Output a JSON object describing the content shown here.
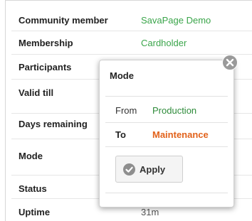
{
  "info": {
    "rows": [
      {
        "label": "Community member",
        "value": "SavaPage Demo"
      },
      {
        "label": "Membership",
        "value": "Cardholder"
      },
      {
        "label": "Participants",
        "value": ""
      },
      {
        "label": "Valid till",
        "value": ""
      },
      {
        "label": "Days remaining",
        "value": ""
      },
      {
        "label": "Mode",
        "value": ""
      },
      {
        "label": "Status",
        "value": ""
      },
      {
        "label": "Uptime",
        "value": "31m"
      }
    ]
  },
  "popup": {
    "title": "Mode",
    "from_label": "From",
    "from_value": "Production",
    "to_label": "To",
    "to_value": "Maintenance",
    "apply_label": "Apply",
    "close_icon": "close-icon",
    "apply_icon": "check-icon"
  },
  "colors": {
    "green": "#3aa54a",
    "production": "#2e8b3a",
    "maintenance": "#e2621b"
  }
}
